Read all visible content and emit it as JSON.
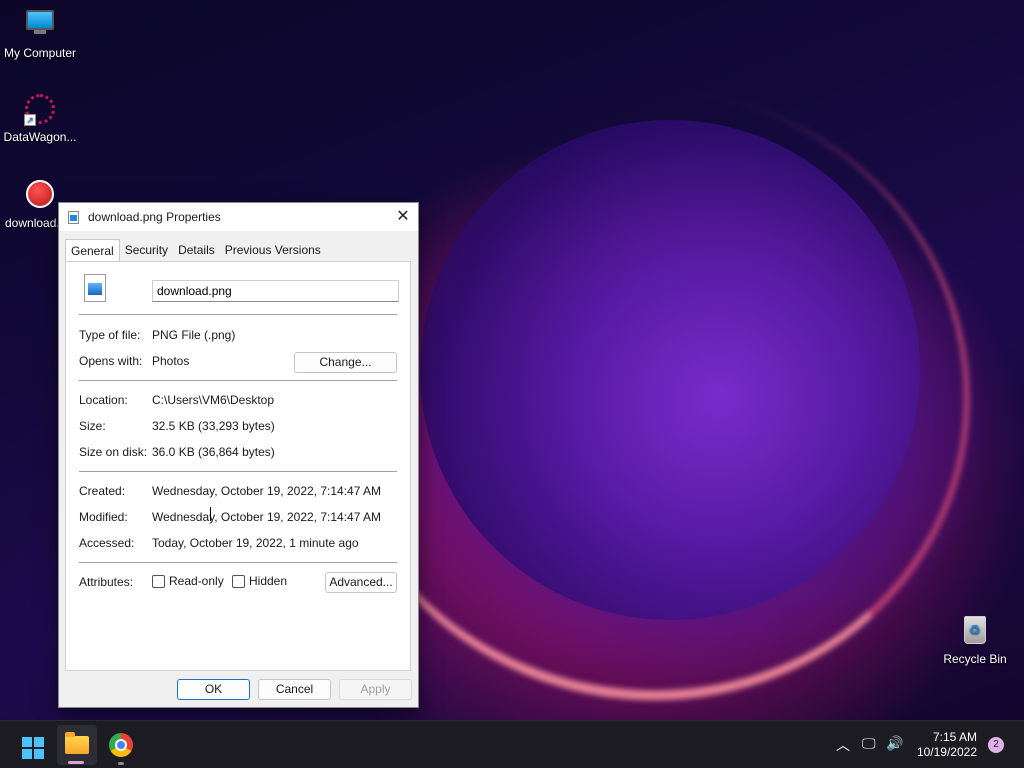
{
  "desktop": {
    "icons": [
      {
        "label": "My Computer"
      },
      {
        "label": "DataWagon..."
      },
      {
        "label": "download.png"
      },
      {
        "label": "Recycle Bin"
      }
    ]
  },
  "dialog": {
    "title": "download.png Properties",
    "tabs": [
      "General",
      "Security",
      "Details",
      "Previous Versions"
    ],
    "active_tab": "General",
    "filename": "download.png",
    "type_label": "Type of file:",
    "type_value": "PNG File (.png)",
    "opens_label": "Opens with:",
    "opens_value": "Photos",
    "change_button": "Change...",
    "location_label": "Location:",
    "location_value": "C:\\Users\\VM6\\Desktop",
    "size_label": "Size:",
    "size_value": "32.5 KB (33,293 bytes)",
    "size_disk_label": "Size on disk:",
    "size_disk_value": "36.0 KB (36,864 bytes)",
    "created_label": "Created:",
    "created_value": "Wednesday, October 19, 2022, 7:14:47 AM",
    "modified_label": "Modified:",
    "modified_value": "Wednesday, October 19, 2022, 7:14:47 AM",
    "accessed_label": "Accessed:",
    "accessed_value": "Today, October 19, 2022, 1 minute ago",
    "attributes_label": "Attributes:",
    "readonly_label": "Read-only",
    "hidden_label": "Hidden",
    "advanced_button": "Advanced...",
    "ok_button": "OK",
    "cancel_button": "Cancel",
    "apply_button": "Apply"
  },
  "taskbar": {
    "time": "7:15 AM",
    "date": "10/19/2022",
    "notifications": "2"
  }
}
